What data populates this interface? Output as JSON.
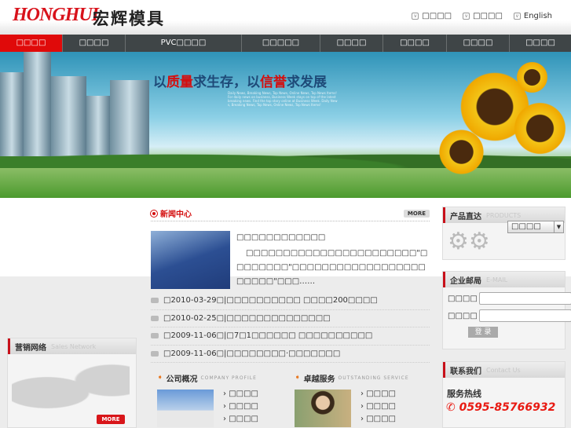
{
  "header": {
    "logo_text": "HONGHUI",
    "logo_cn": "宏辉模具",
    "links": [
      "□□□□",
      "□□□□",
      "English"
    ]
  },
  "nav": [
    "□□□□",
    "□□□□",
    "PVC□□□□",
    "□□□□□",
    "□□□□",
    "□□□□",
    "□□□□",
    "□□□□"
  ],
  "banner": {
    "slogan_a": "以",
    "slogan_b": "质量",
    "slogan_c": "求生存，以",
    "slogan_d": "信誉",
    "slogan_e": "求发展",
    "small_text": "Daily News, Breaking News, Top News, Online News, Top News Items! For daily news on business, Business Week stays on top of the latest breaking news. Find the top story online at Business Week. Daily News, Breaking News, Top News, Online News, Top News Items!"
  },
  "news": {
    "title": "新闻中心",
    "more": "MORE",
    "featured_title": "□□□□□□□□□□□□",
    "featured_body": "□□□□□□□□□□□□□□□□□□□□□□□\"□□□□□□□□\"□□□□□□□□□□□□□□□□□□□□□□□\"□□□……",
    "items": [
      "□2010-03-29□|□□□□□□□□□□ □□□□200□□□□",
      "□2010-02-25□|□□□□□□□□□□□□□□",
      "□2009-11-06□|□7□1□□□□□□ □□□□□□□□□□",
      "□2009-11-06□|□□□□□□□□·□□□□□□□"
    ]
  },
  "products": {
    "title": "产品直达",
    "sub": "PRODUCTS",
    "select_value": "□□□□"
  },
  "email": {
    "title": "企业邮局",
    "sub": "E-MAIL",
    "user_label": "□□□□",
    "pass_label": "□□□□",
    "login": "登 录"
  },
  "contact": {
    "title": "联系我们",
    "sub": "Contact Us",
    "hotline_label": "服务热线",
    "phone": "0595-85766932"
  },
  "sales": {
    "title": "营销网络",
    "sub": "Sales Network",
    "more": "MORE"
  },
  "company": {
    "title": "公司概况",
    "sub": "COMPANY PROFILE",
    "links": [
      "□□□□",
      "□□□□",
      "□□□□"
    ]
  },
  "service": {
    "title": "卓越服务",
    "sub": "OUTSTANDING SERVICE",
    "links": [
      "□□□□",
      "□□□□",
      "□□□□"
    ]
  }
}
